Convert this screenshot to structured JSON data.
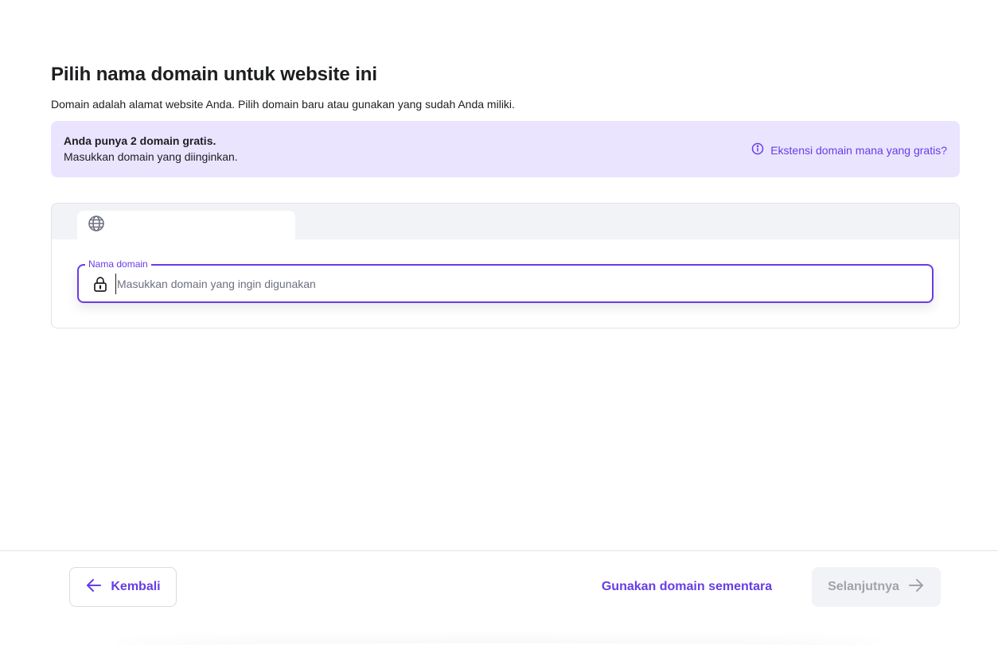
{
  "page": {
    "title": "Pilih nama domain untuk website ini",
    "subtitle": "Domain adalah alamat website Anda. Pilih domain baru atau gunakan yang sudah Anda miliki."
  },
  "banner": {
    "title": "Anda punya 2 domain gratis.",
    "text": "Masukkan domain yang diinginkan.",
    "link_label": "Ekstensi domain mana yang gratis?"
  },
  "domain_panel": {
    "tab_icon": "globe-icon",
    "field_label": "Nama domain",
    "field_icon": "lock-icon",
    "input_value": "",
    "input_placeholder": "Masukkan domain yang ingin digunakan"
  },
  "footer": {
    "back_label": "Kembali",
    "back_icon": "arrow-left-icon",
    "temp_domain_label": "Gunakan domain sementara",
    "next_label": "Selanjutnya",
    "next_icon": "arrow-right-icon"
  },
  "colors": {
    "accent": "#673de6",
    "banner_bg": "#ebe4ff",
    "disabled_bg": "#f2f3f6",
    "disabled_text": "#a2a3aa"
  }
}
